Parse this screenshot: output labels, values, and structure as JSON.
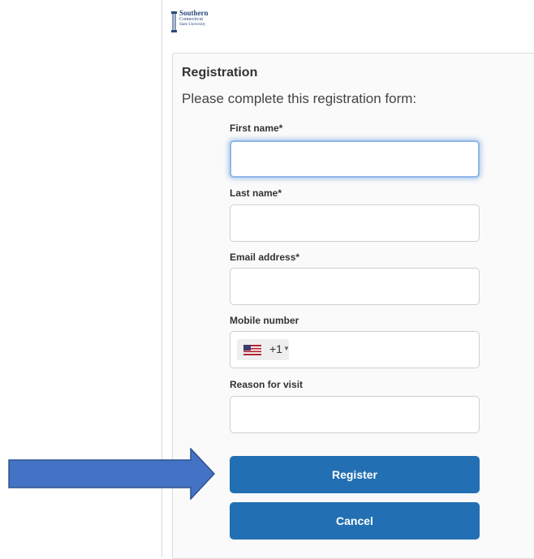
{
  "logo": {
    "line1": "Southern",
    "line2": "Connecticut",
    "line3": "State University"
  },
  "form": {
    "title": "Registration",
    "subtitle": "Please complete this registration form:",
    "fields": {
      "first_name": {
        "label": "First name*",
        "value": ""
      },
      "last_name": {
        "label": "Last name*",
        "value": ""
      },
      "email": {
        "label": "Email address*",
        "value": ""
      },
      "mobile": {
        "label": "Mobile number",
        "country_code": "+1",
        "value": ""
      },
      "reason": {
        "label": "Reason for visit",
        "value": ""
      }
    },
    "buttons": {
      "register": "Register",
      "cancel": "Cancel"
    }
  },
  "colors": {
    "primary_button": "#2270b3",
    "arrow_fill": "#4472c4",
    "focus_glow": "#8fb7e8"
  },
  "icons": {
    "flag": "us-flag-icon",
    "chevron": "chevron-down-icon",
    "pointer": "arrow-right-icon"
  }
}
